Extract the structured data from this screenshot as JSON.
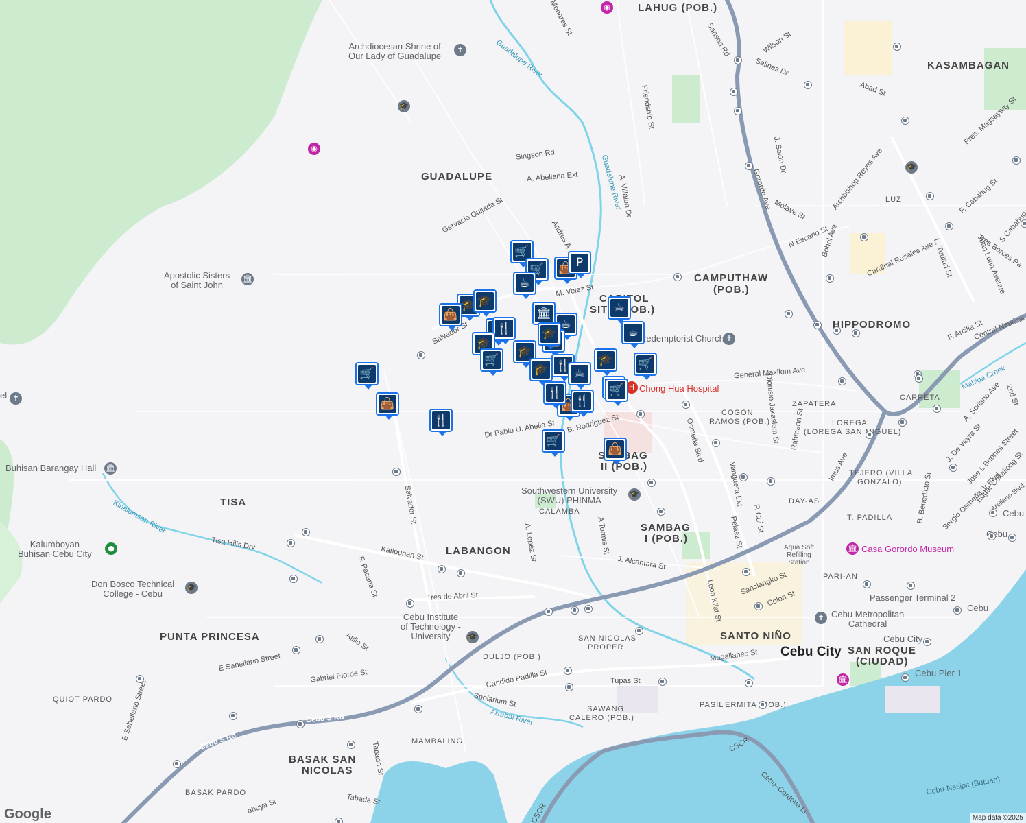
{
  "colors": {
    "background": "#f4f3f6",
    "park": "#cdeccf",
    "water": "#8cd3e9",
    "highway": "#8a9ab3",
    "river": "#7fd4ea",
    "pin_border": "#1a73e8",
    "pin_fill": "#0d3a6a",
    "hospital": "#d93025"
  },
  "areas": {
    "lahug": "LAHUG (POB.)",
    "kasambagan": "KASAMBAGAN",
    "guadalupe": "GUADALUPE",
    "camputhaw_1": "CAMPUTHAW",
    "camputhaw_2": "(POB.)",
    "capitol_1": "CAPITOL",
    "capitol_2": "SITE (POB.)",
    "hippodromo": "HIPPODROMO",
    "luz": "LUZ",
    "carreta": "CARRETA",
    "zapatera": "ZAPATERA",
    "cogon_1": "COGON",
    "cogon_2": "RAMOS (POB.)",
    "lorega_1": "LOREGA",
    "lorega_2": "(LOREGA SAN MIGUEL)",
    "tejero_1": "TEJERO (VILLA",
    "tejero_2": "GONZALO)",
    "dayas": "DAY-AS",
    "tpadilla": "T. PADILLA",
    "sambag2_1": "SAMBAG",
    "sambag2_2": "II (POB.)",
    "calamba": "CALAMBA",
    "sambag1_1": "SAMBAG",
    "sambag1_2": "I (POB.)",
    "tisa": "TISA",
    "labangon": "LABANGON",
    "pari_an": "PARI-AN",
    "santo_nino": "SANTO NIÑO",
    "punta_princesa": "PUNTA PRINCESA",
    "san_nicolas_1": "SAN NICOLAS",
    "san_nicolas_2": "PROPER",
    "duljo": "DULJO (POB.)",
    "san_roque_1": "SAN ROQUE",
    "san_roque_2": "(CIUDAD)",
    "quiot": "QUIOT PARDO",
    "sawang_1": "SAWANG",
    "sawang_2": "CALERO (POB.)",
    "pasil": "PASIL",
    "ermita": "ERMITA (POB.)",
    "mambaling": "MAMBALING",
    "basak_sn_1": "BASAK SAN",
    "basak_sn_2": "NICOLAS",
    "basak_pardo": "BASAK PARDO",
    "cebu_city": "Cebu City"
  },
  "streets": {
    "monares": "Monares St",
    "sanson": "Sanson Rd",
    "wilson": "Wilson St",
    "salinas": "Salinas Dr",
    "abad": "Abad St",
    "friendship": "Friendship St",
    "singson": "Singson Rd",
    "abellana_ext": "A. Abellana Ext",
    "gervacio": "Gervacio Quijada St",
    "villalon": "A. Villalon Dr",
    "andres": "Andres A",
    "mvelez": "M. Velez St",
    "salvador_top": "Salvador St",
    "salvador_low": "Salvador St",
    "jsolon": "J. Solon Dr",
    "gorordo": "Gorordo Ave",
    "molave": "Molave St",
    "nescario": "N Escario St",
    "archbishop": "Archbishop Reyes Ave",
    "bohol": "Bohol Ave",
    "rosales": "Cardinal Rosales Ave",
    "fcabahug": "F. Cabahug St",
    "pres_mag": "Pres. Magsaysay St",
    "tudtud": "L. Tudtud St",
    "juan_luna": "Juan Luna Avenue",
    "tres_borces": "Tres Borces Pa",
    "scabahug": "S Cabahug",
    "farcilla": "F. Arcilla St",
    "central_nautical": "Central Nautical",
    "mahiga": "Mahiga Creek",
    "soriano": "A. Soriano Ave",
    "second": "2nd St",
    "general_max": "General Maxilom Ave",
    "dionisio": "Dionisio Jakaslem St",
    "rahmann": "Rahmann St",
    "imus": "Imus Ave",
    "jdevevra": "J. De Veyra St",
    "jose_briones": "Jose L Briones Street",
    "edgar": "Edgar Cokaliong St",
    "sergio": "Sergio Osmeña Jr Blvd",
    "arellano": "Arellano Blvd",
    "benedicto": "B. Benedicto St",
    "pablo": "Dr Pablo U. Abella St",
    "brodriguez": "B. Rodriguez St",
    "osmena": "Osmeña Blvd",
    "vanguera": "Vanguera Ext",
    "pcui": "P. Cui St",
    "pelaez": "Pelaez St",
    "alopez": "A. Lopez St",
    "atormis": "A Tormis St",
    "jalcantara": "J. Alcantara St",
    "leonkilat": "Leon Kilat St",
    "sanciangko": "Sanciangko St",
    "colon": "Colon St",
    "tisa_hills": "Tisa Hills Drv",
    "katipunan": "Katipunan St",
    "fpacana": "F. Pacana St",
    "tres_abril": "Tres de Abril St",
    "esabellano": "E Sabellano Street",
    "atillo": "Atillo St",
    "gabriel": "Gabriel Elorde St",
    "candido": "Candido Padilla St",
    "tupas": "Tupas St",
    "magallanes": "Magallanes St",
    "spolarium": "Spolarium St",
    "arrabal": "Arrabal River",
    "cebu_srd": "Cebu S Rd",
    "cebu_srd2": "Cebu S Rd",
    "esabellano2": "E Sabellano Street",
    "tabada": "Tabada St",
    "tabada2": "Tabada St",
    "abuya": "abuya St",
    "cscr": "CSCR",
    "cscr2": "CSCR",
    "cebu_cordova": "Cebu–Cordova Li",
    "guadalupe_river": "Guadalupe River",
    "guadalupe_river2": "Guadalupe River",
    "kinalumsan": "Kinalumsan River",
    "cebu_nasipit": "Cebu-Nasipit (Butuan)"
  },
  "pois": {
    "archdiocesan": "Archdiocesan Shrine of Our Lady of Guadalupe",
    "archdiocesan_1": "Archdiocesan Shrine of",
    "archdiocesan_2": "Our Lady of Guadalupe",
    "apostolic_1": "Apostolic Sisters",
    "apostolic_2": "of Saint John",
    "redemptorist": "Redemptorist Church",
    "chong_hua": "Chong Hua Hospital",
    "buhisan_hall": "Buhisan Barangay Hall",
    "kalumboyan_1": "Kalumboyan",
    "kalumboyan_2": "Buhisan Cebu City",
    "don_bosco_1": "Don Bosco Technical",
    "don_bosco_2": "College - Cebu",
    "swu_1": "Southwestern University",
    "swu_2": "(SWU) PHINMA",
    "cit_1": "Cebu Institute",
    "cit_2": "of Technology -",
    "cit_3": "University",
    "aqua_1": "Aqua Soft",
    "aqua_2": "Refilling",
    "aqua_3": "Station",
    "casa": "Casa Gorordo Museum",
    "passenger": "Passenger Terminal 2",
    "cebu_1": "Cebu",
    "cebu_2": "Cebu",
    "cebu_3": "Cebu",
    "cebu_city_label": "Cebu City",
    "metro_1": "Cebu Metropolitan",
    "metro_2": "Cathedral",
    "pier": "Cebu Pier 1",
    "chapel_left": "el"
  },
  "map_pins": [
    {
      "icon": "cart"
    },
    {
      "icon": "bag"
    },
    {
      "icon": "parking"
    },
    {
      "icon": "cart"
    },
    {
      "icon": "cafe"
    },
    {
      "icon": "school"
    },
    {
      "icon": "school"
    },
    {
      "icon": "bag"
    },
    {
      "icon": "restaurant"
    },
    {
      "icon": "restaurant"
    },
    {
      "icon": "museum"
    },
    {
      "icon": "cafe"
    },
    {
      "icon": "bag"
    },
    {
      "icon": "school"
    },
    {
      "icon": "school"
    },
    {
      "icon": "cart"
    },
    {
      "icon": "school"
    },
    {
      "icon": "restaurant"
    },
    {
      "icon": "cafe"
    },
    {
      "icon": "school"
    },
    {
      "icon": "cart"
    },
    {
      "icon": "cafe"
    },
    {
      "icon": "cafe"
    },
    {
      "icon": "cart"
    },
    {
      "icon": "cart"
    },
    {
      "icon": "cart"
    },
    {
      "icon": "bag"
    },
    {
      "icon": "restaurant"
    },
    {
      "icon": "restaurant"
    },
    {
      "icon": "bag"
    },
    {
      "icon": "cart"
    },
    {
      "icon": "bag"
    },
    {
      "icon": "school"
    },
    {
      "icon": "restaurant"
    }
  ],
  "pin_glyphs": {
    "cart": "🛒",
    "bag": "👜",
    "parking": "P",
    "cafe": "☕",
    "school": "🎓",
    "restaurant": "🍴",
    "museum": "🏛"
  },
  "google_logo": "Google",
  "attribution": "Map data ©2025"
}
